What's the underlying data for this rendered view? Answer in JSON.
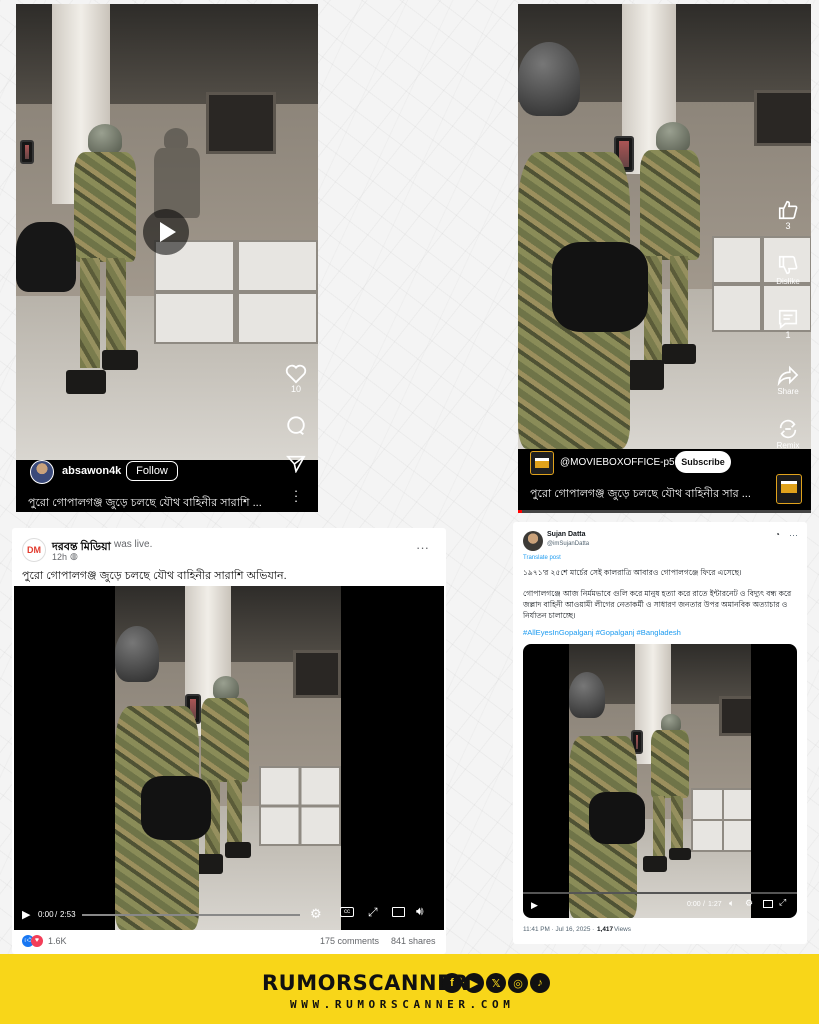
{
  "panel1": {
    "like_count": "10",
    "username": "absawon4k",
    "follow_label": "Follow",
    "caption": "পুরো গোপালগঞ্জ জুড়ে চলছে যৌথ বাহিনীর সারাশি ..."
  },
  "panel2": {
    "like_count": "3",
    "dislike_label": "Dislike",
    "comment_count": "1",
    "share_label": "Share",
    "remix_label": "Remix",
    "channel": "@MOVIEBOXOFFICE-p5i",
    "subscribe_label": "Subscribe",
    "caption": "পুরো গোপালগঞ্জ জুড়ে চলছে যৌথ বাহিনীর সার ..."
  },
  "panel3": {
    "page_name": "দরবন্ত মিডিয়া",
    "was_live": "was live.",
    "time": "12h",
    "more": "···",
    "post_text": "পুরো গোপালগঞ্জ জুড়ে চলছে যৌথ বাহিনীর সারাশি অভিযান.",
    "time_current": "0:00",
    "time_sep": "/",
    "time_total": "2:53",
    "reactions_count": "1.6K",
    "comments": "175 comments",
    "shares": "841 shares",
    "avatar_text": "DM"
  },
  "panel4": {
    "display_name": "Sujan Datta",
    "handle": "@imSujanDatta",
    "translate": "Translate post",
    "line1": "১৯৭১'র ২৫শে মার্চের সেই কালরাত্রি আবারও গোপালগঞ্জে ফিরে এসেছে।",
    "line2": "গোপালগঞ্জে আজ নির্মমভাবে গুলি করে মানুষ হত্যা করে রাতে ইন্টারনেট ও বিদ্যুৎ বন্ধ করে জল্লাদ বাহিনী আওয়ামী লীগের নেতাকর্মী ও সাধারণ জনতার উপর অমানবিক অত্যাচার ও নির্যাতন চালাচ্ছে।",
    "hashtags": "#AllEyesInGopalganj #Gopalganj #Bangladesh",
    "time_current": "0:00",
    "time_sep": "/",
    "time_total": "1:27",
    "post_time": "11:41 PM · Jul 16, 2025 · ",
    "views_count": "1,417",
    "views_label": " Views"
  },
  "footer": {
    "brand": "RUMORSCANNER",
    "site": "WWW.RUMORSCANNER.COM"
  },
  "colors": {
    "footer_bg": "#f8d619",
    "link_blue": "#1d9bf0",
    "fb_blue": "#1877f2"
  }
}
